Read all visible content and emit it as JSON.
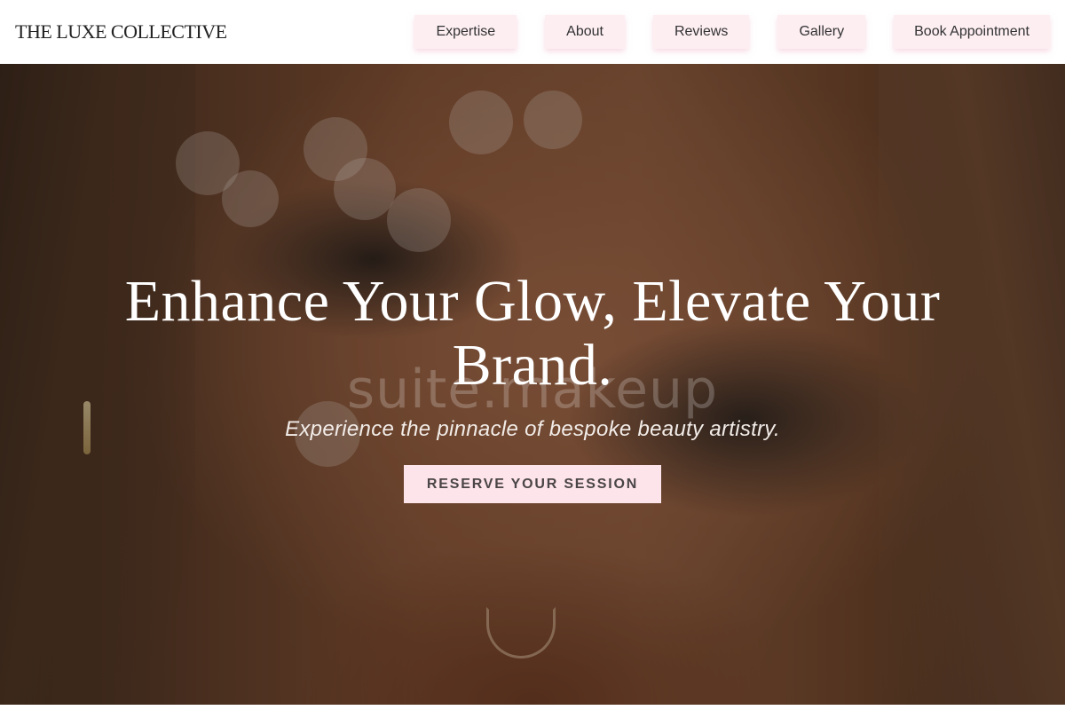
{
  "header": {
    "logo": "THE LUXE COLLECTIVE",
    "nav": [
      {
        "label": "Expertise"
      },
      {
        "label": "About"
      },
      {
        "label": "Reviews"
      },
      {
        "label": "Gallery"
      },
      {
        "label": "Book Appointment"
      }
    ]
  },
  "hero": {
    "headline": "Enhance Your Glow, Elevate Your Brand.",
    "watermark": "suite.makeup",
    "subheadline": "Experience the pinnacle of bespoke beauty artistry.",
    "cta_label": "RESERVE YOUR SESSION"
  },
  "colors": {
    "nav_button_bg": "#fdeef2",
    "cta_bg": "#fde3ea",
    "headline_text": "#ffffff"
  }
}
